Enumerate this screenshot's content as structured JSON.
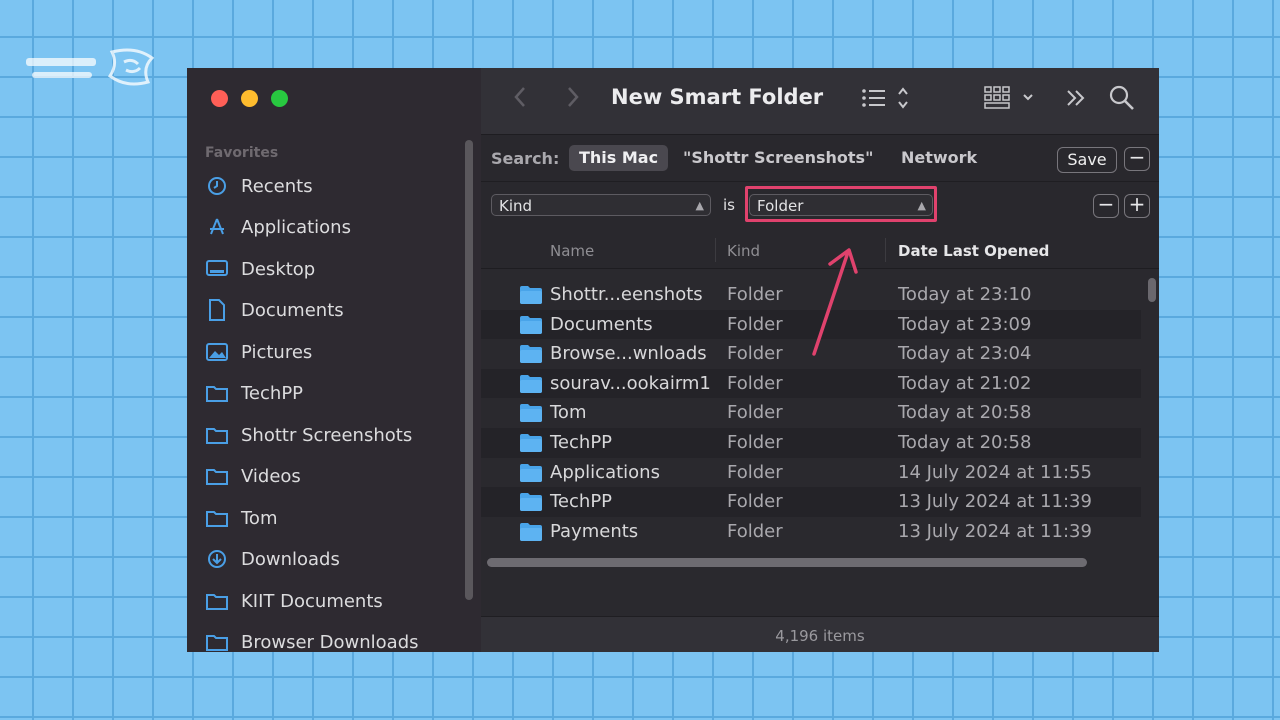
{
  "colors": {
    "highlight": "#e0426d",
    "folder_blue": "#49a4e9",
    "background": "#7cc4f2"
  },
  "window": {
    "title": "New Smart Folder"
  },
  "sidebar": {
    "section_title": "Favorites",
    "items": [
      {
        "label": "Recents",
        "icon": "clock-icon"
      },
      {
        "label": "Applications",
        "icon": "applications-icon"
      },
      {
        "label": "Desktop",
        "icon": "desktop-icon"
      },
      {
        "label": "Documents",
        "icon": "document-icon"
      },
      {
        "label": "Pictures",
        "icon": "pictures-icon"
      },
      {
        "label": "TechPP",
        "icon": "folder-icon"
      },
      {
        "label": "Shottr Screenshots",
        "icon": "folder-icon"
      },
      {
        "label": "Videos",
        "icon": "folder-icon"
      },
      {
        "label": "Tom",
        "icon": "folder-icon"
      },
      {
        "label": "Downloads",
        "icon": "download-icon"
      },
      {
        "label": "KIIT Documents",
        "icon": "folder-icon"
      },
      {
        "label": "Browser Downloads",
        "icon": "folder-icon"
      }
    ]
  },
  "search": {
    "label": "Search:",
    "scopes": [
      "This Mac",
      "\"Shottr Screenshots\"",
      "Network"
    ],
    "active_scope": "This Mac",
    "save_label": "Save",
    "minus_label": "−",
    "plus_label": "+"
  },
  "criteria": {
    "attribute": "Kind",
    "operator": "is",
    "value": "Folder"
  },
  "columns": {
    "name": "Name",
    "kind": "Kind",
    "date": "Date Last Opened"
  },
  "rows": [
    {
      "name": "Shottr...eenshots",
      "kind": "Folder",
      "date": "Today at 23:10"
    },
    {
      "name": "Documents",
      "kind": "Folder",
      "date": "Today at 23:09"
    },
    {
      "name": "Browse...wnloads",
      "kind": "Folder",
      "date": "Today at 23:04"
    },
    {
      "name": "sourav...ookairm1",
      "kind": "Folder",
      "date": "Today at 21:02"
    },
    {
      "name": "Tom",
      "kind": "Folder",
      "date": "Today at 20:58"
    },
    {
      "name": "TechPP",
      "kind": "Folder",
      "date": "Today at 20:58"
    },
    {
      "name": "Applications",
      "kind": "Folder",
      "date": "14 July 2024 at 11:55"
    },
    {
      "name": "TechPP",
      "kind": "Folder",
      "date": "13 July 2024 at 11:39"
    },
    {
      "name": "Payments",
      "kind": "Folder",
      "date": "13 July 2024 at 11:39"
    }
  ],
  "status": {
    "item_count": "4,196 items"
  }
}
